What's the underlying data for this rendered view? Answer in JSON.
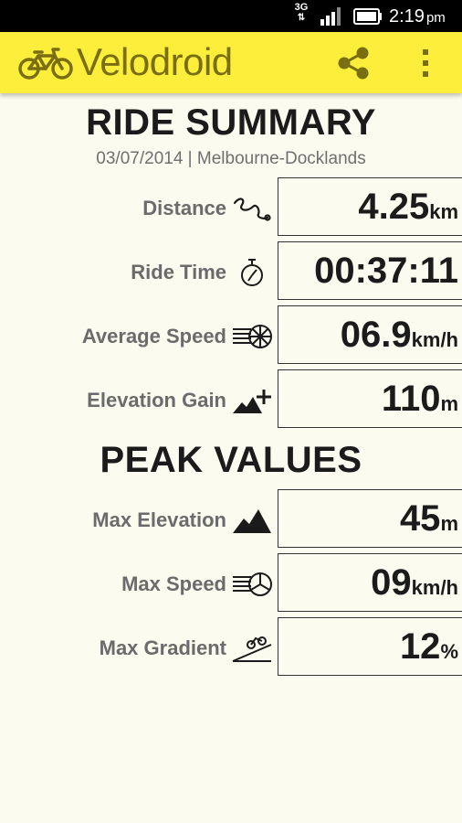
{
  "status_bar": {
    "network": "3G",
    "time": "2:19",
    "ampm": "pm"
  },
  "app_bar": {
    "title": "Velodroid",
    "icons": [
      "bicycle-icon",
      "share-icon",
      "overflow-menu-icon"
    ]
  },
  "ride_summary": {
    "title": "RIDE SUMMARY",
    "subtitle": "03/07/2014 | Melbourne-Docklands",
    "rows": [
      {
        "label": "Distance",
        "value": "4.25",
        "unit": "km",
        "icon": "route-icon"
      },
      {
        "label": "Ride Time",
        "value": "00:37:11",
        "unit": "",
        "icon": "stopwatch-icon"
      },
      {
        "label": "Average Speed",
        "value": "06.9",
        "unit": "km/h",
        "icon": "speed-wheel-icon"
      },
      {
        "label": "Elevation Gain",
        "value": "110",
        "unit": "m",
        "icon": "mountain-plus-icon"
      }
    ]
  },
  "peak_values": {
    "title": "PEAK VALUES",
    "rows": [
      {
        "label": "Max Elevation",
        "value": "45",
        "unit": "m",
        "icon": "mountain-icon"
      },
      {
        "label": "Max Speed",
        "value": "09",
        "unit": "km/h",
        "icon": "speed-wheel-icon"
      },
      {
        "label": "Max Gradient",
        "value": "12",
        "unit": "%",
        "icon": "gradient-slope-icon"
      }
    ]
  },
  "colors": {
    "app_bar": "#fcee3a",
    "logo": "#7a6e12",
    "background": "#fbfbef",
    "status_bar": "#000000"
  }
}
